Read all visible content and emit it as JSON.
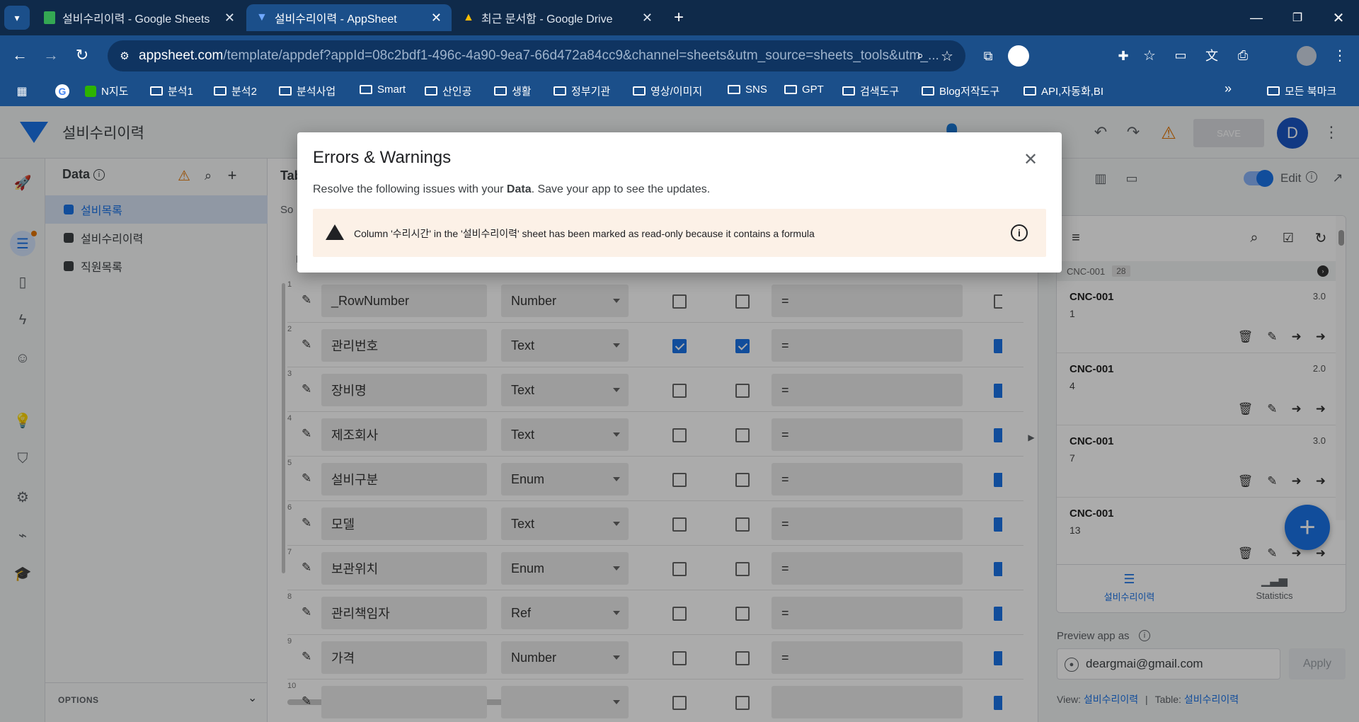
{
  "browser": {
    "tabs": [
      {
        "title": "설비수리이력 - Google Sheets",
        "icon": "google-sheets-icon",
        "color": "#34a853"
      },
      {
        "title": "설비수리이력 - AppSheet",
        "icon": "appsheet-icon",
        "color": "#4285f4"
      },
      {
        "title": "최근 문서함 - Google Drive",
        "icon": "google-drive-icon",
        "color": "#fbbc04"
      }
    ],
    "url_host": "appsheet.com",
    "url_rest": "/template/appdef?appId=08c2bdf1-496c-4a90-9ea7-66d472a84cc9&channel=sheets&utm_source=sheets_tools&utm_...",
    "bookmarks": [
      "N지도",
      "분석1",
      "분석2",
      "분석사업",
      "Smart",
      "산인공",
      "생활",
      "정부기관",
      "영상/이미지",
      "SNS",
      "GPT",
      "검색도구",
      "Blog저작도구",
      "API,자동화,BI"
    ],
    "all_bookmarks": "모든 북마크",
    "bookmarks_more": "»"
  },
  "app": {
    "title": "설비수리이력",
    "save_label": "SAVE",
    "avatar_letter": "D",
    "accent": "#1a73e8"
  },
  "data_panel": {
    "heading": "Data",
    "tables": [
      "설비목록",
      "설비수리이력",
      "직원목록"
    ],
    "options_label": "OPTIONS",
    "chevron": "⌄"
  },
  "editor": {
    "tab_label": "Tab",
    "source_label": "So",
    "marker": "I",
    "columns": [
      {
        "num": "1",
        "name": "_RowNumber",
        "type": "Number",
        "key": false,
        "label": false,
        "formula": "=",
        "edge": false
      },
      {
        "num": "2",
        "name": "관리번호",
        "type": "Text",
        "key": true,
        "label": true,
        "formula": "=",
        "edge": true
      },
      {
        "num": "3",
        "name": "장비명",
        "type": "Text",
        "key": false,
        "label": false,
        "formula": "=",
        "edge": true
      },
      {
        "num": "4",
        "name": "제조회사",
        "type": "Text",
        "key": false,
        "label": false,
        "formula": "=",
        "edge": true
      },
      {
        "num": "5",
        "name": "설비구분",
        "type": "Enum",
        "key": false,
        "label": false,
        "formula": "=",
        "edge": true
      },
      {
        "num": "6",
        "name": "모델",
        "type": "Text",
        "key": false,
        "label": false,
        "formula": "=",
        "edge": true
      },
      {
        "num": "7",
        "name": "보관위치",
        "type": "Enum",
        "key": false,
        "label": false,
        "formula": "=",
        "edge": true
      },
      {
        "num": "8",
        "name": "관리책임자",
        "type": "Ref",
        "key": false,
        "label": false,
        "formula": "=",
        "edge": true
      },
      {
        "num": "9",
        "name": "가격",
        "type": "Number",
        "key": false,
        "label": false,
        "formula": "=",
        "edge": true
      },
      {
        "num": "10",
        "name": "",
        "type": "",
        "key": false,
        "label": false,
        "formula": "",
        "edge": true
      }
    ]
  },
  "preview": {
    "edit_label": "Edit",
    "group_label": "CNC-001",
    "group_count": "28",
    "cards": [
      {
        "title": "CNC-001",
        "sub": "1",
        "value": "3.0"
      },
      {
        "title": "CNC-001",
        "sub": "4",
        "value": "2.0"
      },
      {
        "title": "CNC-001",
        "sub": "7",
        "value": "3.0"
      },
      {
        "title": "CNC-001",
        "sub": "13",
        "value": ""
      }
    ],
    "nav": [
      {
        "label": "설비수리이력",
        "active": true
      },
      {
        "label": "Statistics",
        "active": false
      }
    ],
    "preview_as_label": "Preview app as",
    "email": "deargmai@gmail.com",
    "apply_label": "Apply",
    "view_label": "View:",
    "view_value": "설비수리이력",
    "table_label": "Table:",
    "table_value": "설비수리이력",
    "separator": "|"
  },
  "dialog": {
    "title": "Errors & Warnings",
    "desc_prefix": "Resolve the following issues with your ",
    "desc_bold": "Data",
    "desc_suffix": ". Save your app to see the updates.",
    "warning": "Column '수리시간' in the '설비수리이력' sheet has been marked as read-only because it contains a formula",
    "warning_bg": "#fcf1e7"
  }
}
